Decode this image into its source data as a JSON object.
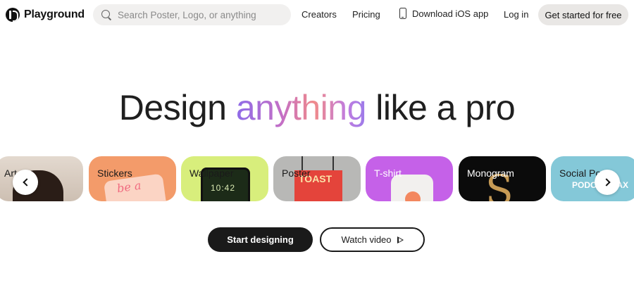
{
  "brand": {
    "name": "Playground"
  },
  "search": {
    "placeholder": "Search Poster, Logo, or anything"
  },
  "nav": {
    "creators": "Creators",
    "pricing": "Pricing",
    "ios": "Download iOS app",
    "login": "Log in",
    "cta": "Get started for free"
  },
  "hero": {
    "word1": "Design",
    "highlight": "anything",
    "word2": "like a pro"
  },
  "carousel": {
    "cards": [
      {
        "label": "Art"
      },
      {
        "label": "Stickers",
        "art_text": "be a"
      },
      {
        "label": "Wallpaper",
        "art_text": "10:42"
      },
      {
        "label": "Poster",
        "art_text": "TOAST"
      },
      {
        "label": "T-shirt"
      },
      {
        "label": "Monogram",
        "art_text": "S"
      },
      {
        "label": "Social Po",
        "art_text": "PODC GALAX"
      }
    ]
  },
  "actions": {
    "start": "Start designing",
    "watch": "Watch video"
  },
  "colors": {
    "accent_gradient": [
      "#8e6be8",
      "#f08a8a",
      "#9a7bea"
    ],
    "primary_button": "#1a1a1a"
  }
}
